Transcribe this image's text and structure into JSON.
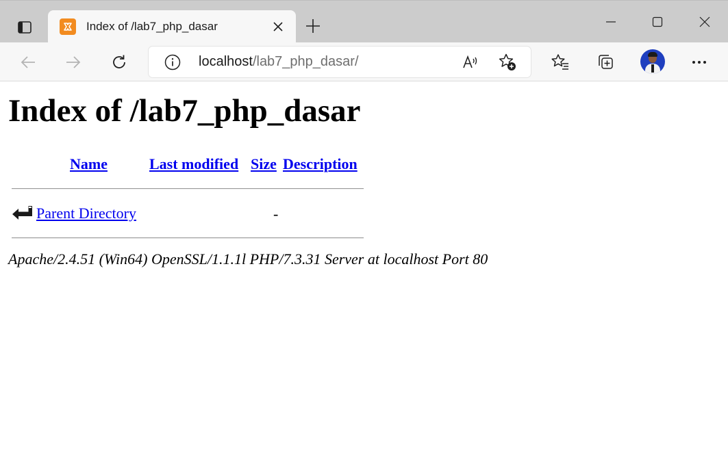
{
  "browser": {
    "tab": {
      "title": "Index of /lab7_php_dasar",
      "favicon": "xampp-icon"
    },
    "address_bar": {
      "host": "localhost",
      "path": "/lab7_php_dasar/"
    },
    "icons": {
      "tab_actions": "tab-actions-icon",
      "close_tab": "close-icon",
      "new_tab": "plus-icon",
      "minimize": "minimize-icon",
      "maximize": "maximize-icon",
      "close_window": "close-icon",
      "back": "arrow-left-icon",
      "forward": "arrow-right-icon",
      "refresh": "refresh-icon",
      "site_info": "info-icon",
      "read_aloud": "read-aloud-icon",
      "add_favorite": "star-add-icon",
      "favorites": "favorites-icon",
      "collections": "collections-icon",
      "profile": "avatar",
      "more": "more-icon"
    },
    "colors": {
      "titlebar_bg": "#cccccc",
      "toolbar_bg": "#f7f7f7",
      "favicon_orange": "#f28b1f",
      "avatar_blue": "#1f3fbf"
    }
  },
  "page": {
    "title": "Index of /lab7_php_dasar",
    "columns": {
      "name": "Name",
      "last_modified": "Last modified",
      "size": "Size",
      "description": "Description"
    },
    "rows": [
      {
        "icon": "back-arrow-icon",
        "name": "Parent Directory",
        "last_modified": "",
        "size": "-",
        "description": ""
      }
    ],
    "server_signature": "Apache/2.4.51 (Win64) OpenSSL/1.1.1l PHP/7.3.31 Server at localhost Port 80",
    "colors": {
      "link": "#0000ee",
      "text": "#000000"
    }
  }
}
